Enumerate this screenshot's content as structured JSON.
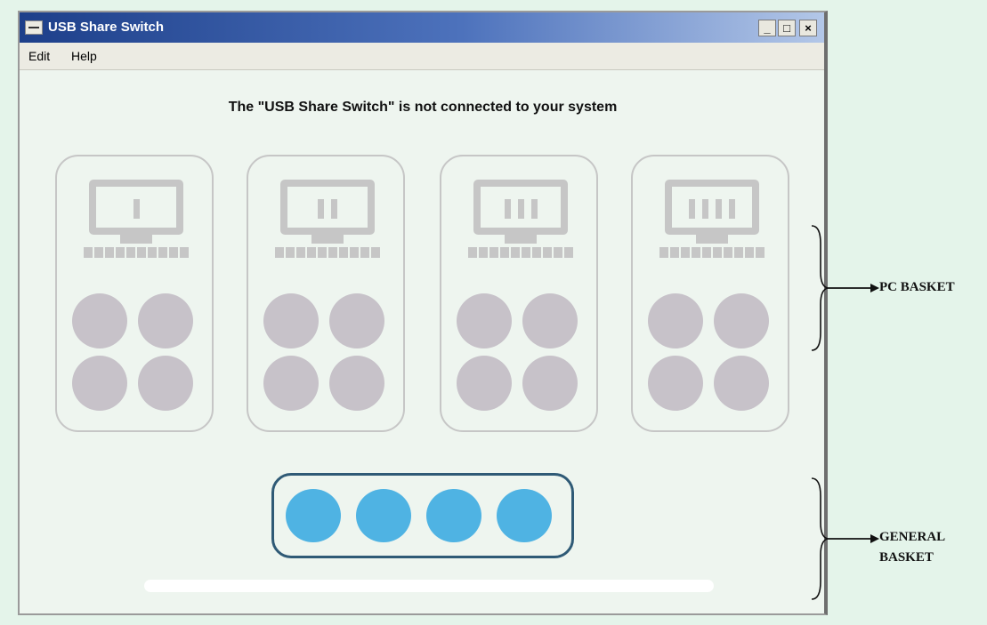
{
  "window": {
    "title": "USB Share Switch",
    "controls": {
      "minimize": "_",
      "maximize": "□",
      "close": "×"
    }
  },
  "menu": {
    "items": [
      "Edit",
      "Help"
    ]
  },
  "status_message": "The \"USB Share Switch\" is not connected to your system",
  "pc_baskets": [
    {
      "bars": 1,
      "ports": 4
    },
    {
      "bars": 2,
      "ports": 4
    },
    {
      "bars": 3,
      "ports": 4
    },
    {
      "bars": 4,
      "ports": 4
    }
  ],
  "general_basket": {
    "ports": 4
  },
  "annotations": {
    "pc_basket": "PC BASKET",
    "general_basket_line1": "GENERAL",
    "general_basket_line2": "BASKET"
  },
  "colors": {
    "titlebar_start": "#1d3f8a",
    "titlebar_end": "#b3c7e8",
    "inactive_gray": "#c6c6c6",
    "inactive_port": "#c7c2c9",
    "active_port": "#4fb3e3",
    "general_basket_border": "#2f5a76",
    "page_background": "#e4f4ea"
  }
}
